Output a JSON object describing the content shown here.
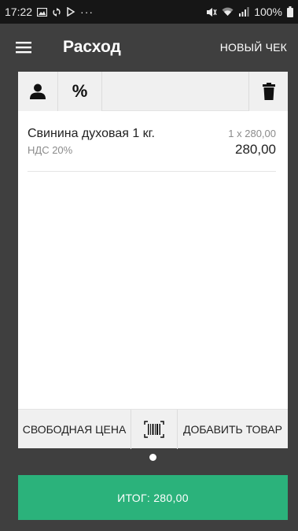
{
  "status_bar": {
    "time": "17:22",
    "more": "···",
    "battery_percent": "100%",
    "icons": [
      "image-icon",
      "sync-icon",
      "play-icon",
      "mute-icon",
      "wifi-icon",
      "signal-icon",
      "battery-icon"
    ]
  },
  "app_bar": {
    "menu_icon": "hamburger-menu-icon",
    "title": "Расход",
    "new_check": "НОВЫЙ ЧЕК"
  },
  "toolbar": {
    "customer_icon": "person-icon",
    "discount_label": "%",
    "delete_icon": "trash-icon"
  },
  "items": [
    {
      "name": "Свинина духовая 1 кг.",
      "vat": "НДС 20%",
      "qty_price": "1 x 280,00",
      "total": "280,00"
    }
  ],
  "bottom_bar": {
    "free_price": "СВОБОДНАЯ ЦЕНА",
    "barcode_icon": "barcode-scan-icon",
    "add_item": "ДОБАВИТЬ ТОВАР"
  },
  "pager": {
    "pages": 1,
    "current": 1
  },
  "total_button": {
    "label": "ИТОГ: 280,00"
  },
  "colors": {
    "status_bar_bg": "#161616",
    "app_bar_bg": "#3f3f3f",
    "accent_green": "#2bb27b",
    "card_bg": "#ffffff",
    "toolbar_bg": "#f0f0f0",
    "secondary_text": "#8b8b8b"
  }
}
